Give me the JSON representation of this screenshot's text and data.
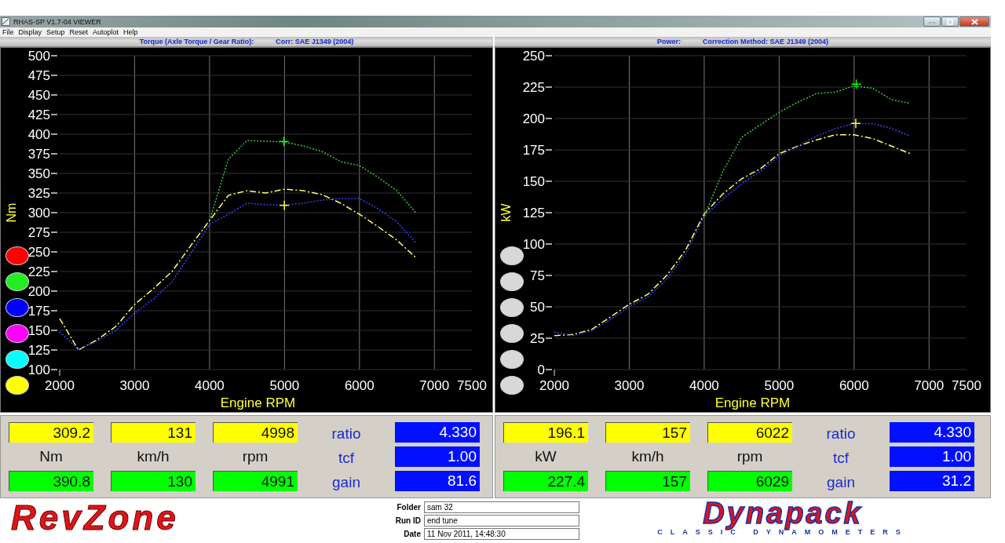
{
  "window": {
    "title": "RHAS-SP V1.7-04  VIEWER"
  },
  "menu": [
    "File",
    "Display",
    "Setup",
    "Reset",
    "Autoplot",
    "Help"
  ],
  "charts": [
    {
      "header": [
        "Torque (Axle Torque / Gear Ratio):",
        "Corr: SAE J1349 (2004)"
      ],
      "run_buttons": [
        {
          "color": "#ff0000"
        },
        {
          "color": "#22ee22"
        },
        {
          "color": "#0000ff"
        },
        {
          "color": "#ff00ff"
        },
        {
          "color": "#00ffff"
        },
        {
          "color": "#ffff00"
        }
      ],
      "chart_data": {
        "type": "line",
        "xlabel": "Engine RPM",
        "ylabel": "Nm",
        "xlim": [
          2000,
          7500
        ],
        "ylim": [
          100,
          500
        ],
        "xticks": [
          2000,
          3000,
          4000,
          5000,
          6000,
          7000,
          7500
        ],
        "yticks": [
          100,
          125,
          150,
          175,
          200,
          225,
          250,
          275,
          300,
          325,
          350,
          375,
          400,
          425,
          450,
          475,
          500
        ],
        "x": [
          2000,
          2250,
          2500,
          2750,
          3000,
          3250,
          3500,
          3750,
          4000,
          4250,
          4500,
          4750,
          5000,
          5250,
          5500,
          5750,
          6000,
          6250,
          6500,
          6750
        ],
        "series": [
          {
            "color": "#ffff66",
            "line_style": "dashdot",
            "values": [
              165,
              125,
              138,
              155,
              183,
              203,
              225,
              258,
              290,
              322,
              328,
              325,
              330,
              328,
              323,
              312,
              298,
              282,
              265,
              243
            ]
          },
          {
            "color": "#3344ff",
            "line_style": "dotted",
            "values": [
              148,
              126,
              136,
              150,
              172,
              190,
              212,
              248,
              285,
              298,
              312,
              310,
              310,
              312,
              316,
              318,
              318,
              305,
              288,
              262
            ]
          },
          {
            "color": "#33cc33",
            "line_style": "dotted",
            "values": [
              null,
              null,
              null,
              null,
              null,
              null,
              null,
              null,
              290,
              368,
              392,
              391,
              390,
              385,
              378,
              365,
              360,
              345,
              328,
              300
            ]
          }
        ],
        "grid": true
      },
      "readouts": {
        "measured": {
          "color": "#ffff00",
          "values": [
            "309.2",
            "131",
            "4998"
          ]
        },
        "units": [
          "Nm",
          "km/h",
          "rpm"
        ],
        "peak": {
          "color": "#00ff00",
          "values": [
            "390.8",
            "130",
            "4991"
          ]
        },
        "factors": [
          {
            "label": "ratio",
            "value": "4.330"
          },
          {
            "label": "tcf",
            "value": "1.00"
          },
          {
            "label": "gain",
            "value": "81.6"
          }
        ]
      }
    },
    {
      "header": [
        "Power:",
        "Correction Method: SAE J1349 (2004)"
      ],
      "run_buttons": [
        {
          "color": "#d8d8d8"
        },
        {
          "color": "#d8d8d8"
        },
        {
          "color": "#d8d8d8"
        },
        {
          "color": "#d8d8d8"
        },
        {
          "color": "#d8d8d8"
        },
        {
          "color": "#d8d8d8"
        }
      ],
      "chart_data": {
        "type": "line",
        "xlabel": "Engine RPM",
        "ylabel": "kW",
        "xlim": [
          2000,
          7500
        ],
        "ylim": [
          0,
          250
        ],
        "xticks": [
          2000,
          3000,
          4000,
          5000,
          6000,
          7000,
          7500
        ],
        "yticks": [
          0,
          25,
          50,
          75,
          100,
          125,
          150,
          175,
          200,
          225,
          250
        ],
        "x": [
          2000,
          2250,
          2500,
          2750,
          3000,
          3250,
          3500,
          3750,
          4000,
          4250,
          4500,
          4750,
          5000,
          5250,
          5500,
          5750,
          6000,
          6250,
          6500,
          6750
        ],
        "series": [
          {
            "color": "#ffff66",
            "line_style": "dashdot",
            "values": [
              27,
              28,
              32,
              42,
              52,
              60,
              75,
              95,
              124,
              140,
              152,
              160,
              172,
              178,
              183,
              187,
              187,
              184,
              178,
              172
            ]
          },
          {
            "color": "#3344ff",
            "line_style": "dotted",
            "values": [
              30,
              27,
              31,
              40,
              50,
              58,
              72,
              92,
              122,
              136,
              148,
              158,
              170,
              178,
              186,
              192,
              196,
              196,
              192,
              186
            ]
          },
          {
            "color": "#33cc33",
            "line_style": "dotted",
            "values": [
              null,
              null,
              null,
              null,
              null,
              null,
              null,
              null,
              122,
              158,
              185,
              195,
              205,
              213,
              220,
              221,
              226,
              224,
              215,
              212
            ]
          }
        ],
        "grid": true
      },
      "readouts": {
        "measured": {
          "color": "#ffff00",
          "values": [
            "196.1",
            "157",
            "6022"
          ]
        },
        "units": [
          "kW",
          "km/h",
          "rpm"
        ],
        "peak": {
          "color": "#00ff00",
          "values": [
            "227.4",
            "157",
            "6029"
          ]
        },
        "factors": [
          {
            "label": "ratio",
            "value": "4.330"
          },
          {
            "label": "tcf",
            "value": "1.00"
          },
          {
            "label": "gain",
            "value": "31.2"
          }
        ]
      }
    }
  ],
  "run_info": [
    {
      "label": "Folder",
      "value": "sam 32"
    },
    {
      "label": "Run ID",
      "value": "end tune"
    },
    {
      "label": "Date",
      "value": "11 Nov 2011, 14:48:30"
    }
  ],
  "logos": {
    "left": "RevZone",
    "right": "Dynapack",
    "right_tagline": "CLASSIC DYNAMOMETERS"
  }
}
